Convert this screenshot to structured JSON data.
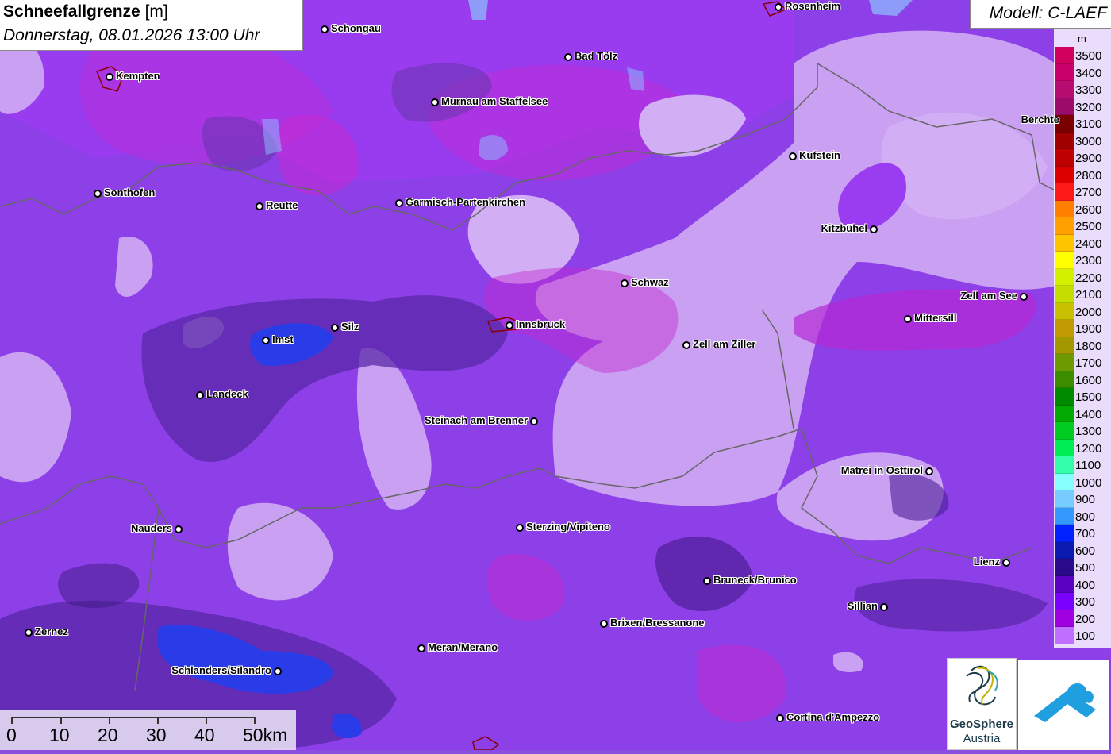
{
  "title": {
    "main_bold": "Schneefallgrenze",
    "main_unit": "[m]",
    "subtitle": "Donnerstag, 08.01.2026 13:00 Uhr"
  },
  "model": {
    "label": "Modell: C-LAEF"
  },
  "legend": {
    "unit": "m",
    "entries": [
      {
        "value": "3500",
        "color": "#d1005e"
      },
      {
        "value": "3400",
        "color": "#c8006a"
      },
      {
        "value": "3300",
        "color": "#b60c70"
      },
      {
        "value": "3200",
        "color": "#9c0a6a"
      },
      {
        "value": "3100",
        "color": "#7a0000"
      },
      {
        "value": "3000",
        "color": "#a00000"
      },
      {
        "value": "2900",
        "color": "#be0000"
      },
      {
        "value": "2800",
        "color": "#dc0000"
      },
      {
        "value": "2700",
        "color": "#ff1a1a"
      },
      {
        "value": "2600",
        "color": "#ff7f00"
      },
      {
        "value": "2500",
        "color": "#ff9f00"
      },
      {
        "value": "2400",
        "color": "#ffc400"
      },
      {
        "value": "2300",
        "color": "#ffff00"
      },
      {
        "value": "2200",
        "color": "#d2f000"
      },
      {
        "value": "2100",
        "color": "#c4dc00"
      },
      {
        "value": "2000",
        "color": "#c8c000"
      },
      {
        "value": "1900",
        "color": "#c09a00"
      },
      {
        "value": "1800",
        "color": "#a39800"
      },
      {
        "value": "1700",
        "color": "#6d9a00"
      },
      {
        "value": "1600",
        "color": "#3c8c00"
      },
      {
        "value": "1500",
        "color": "#008a00"
      },
      {
        "value": "1400",
        "color": "#00aa00"
      },
      {
        "value": "1300",
        "color": "#00cc22"
      },
      {
        "value": "1200",
        "color": "#00ee55"
      },
      {
        "value": "1100",
        "color": "#33ffaa"
      },
      {
        "value": "1000",
        "color": "#88ffff"
      },
      {
        "value": "900",
        "color": "#77ccff"
      },
      {
        "value": "800",
        "color": "#3399ff"
      },
      {
        "value": "700",
        "color": "#0022ff"
      },
      {
        "value": "600",
        "color": "#0a1ab0"
      },
      {
        "value": "500",
        "color": "#2a0a88"
      },
      {
        "value": "400",
        "color": "#5a00c0"
      },
      {
        "value": "300",
        "color": "#7a00ff"
      },
      {
        "value": "200",
        "color": "#a000e0"
      },
      {
        "value": "100",
        "color": "#c070ff"
      }
    ]
  },
  "cities": [
    {
      "name": "Rosenheim"
    },
    {
      "name": "Schongau"
    },
    {
      "name": "Bad Tölz"
    },
    {
      "name": "Kempten"
    },
    {
      "name": "Murnau am Staffelsee"
    },
    {
      "name": "Berchte"
    },
    {
      "name": "Kufstein"
    },
    {
      "name": "Sonthofen"
    },
    {
      "name": "Reutte"
    },
    {
      "name": "Garmisch-Partenkirchen"
    },
    {
      "name": "Kitzbühel"
    },
    {
      "name": "Schwaz"
    },
    {
      "name": "Zell am See"
    },
    {
      "name": "Mittersill"
    },
    {
      "name": "Imst"
    },
    {
      "name": "Silz"
    },
    {
      "name": "Innsbruck"
    },
    {
      "name": "Zell am Ziller"
    },
    {
      "name": "Landeck"
    },
    {
      "name": "Steinach am Brenner"
    },
    {
      "name": "Matrei in Osttirol"
    },
    {
      "name": "Nauders"
    },
    {
      "name": "Sterzing/Vipiteno"
    },
    {
      "name": "Lienz"
    },
    {
      "name": "Bruneck/Brunico"
    },
    {
      "name": "Sillian"
    },
    {
      "name": "Brixen/Bressanone"
    },
    {
      "name": "Zernez"
    },
    {
      "name": "Schlanders/Silandro"
    },
    {
      "name": "Meran/Merano"
    },
    {
      "name": "Cortina d'Ampezzo"
    }
  ],
  "scale_bar": {
    "labels": [
      "0",
      "10",
      "20",
      "30",
      "40",
      "50km"
    ]
  },
  "logos": {
    "geosphere_line1": "GeoSphere",
    "geosphere_line2": "Austria"
  }
}
